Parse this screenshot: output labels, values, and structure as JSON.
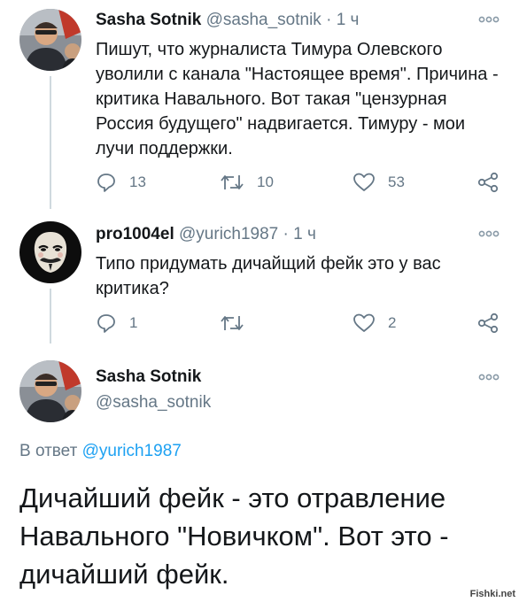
{
  "tweets": [
    {
      "name": "Sasha Sotnik",
      "handle": "@sasha_sotnik",
      "dot": "·",
      "time": "1 ч",
      "text": "Пишут, что журналиста Тимура Олевского уволили с канала \"Настоящее время\". Причина - критика Навального. Вот такая \"цензурная Россия будущего\" надвигается. Тимуру - мои лучи поддержки.",
      "replies": "13",
      "retweets": "10",
      "likes": "53",
      "avatar_icon": "person-photo-icon"
    },
    {
      "name": "pro1004el",
      "handle": "@yurich1987",
      "dot": "·",
      "time": "1 ч",
      "text": "Типо придумать дичайщий фейк это у вас критика?",
      "replies": "1",
      "retweets": "",
      "likes": "2",
      "avatar_icon": "guy-fawkes-mask-icon"
    }
  ],
  "main_tweet": {
    "name": "Sasha Sotnik",
    "handle": "@sasha_sotnik",
    "reply_prefix": "В ответ",
    "reply_handle": "@yurich1987",
    "text": "Дичайший фейк - это отравление Навального \"Новичком\". Вот это - дичайший фейк."
  },
  "watermark": "Fishki.net",
  "colors": {
    "text": "#14171a",
    "secondary": "#657786",
    "link": "#1da1f2",
    "line": "#cfd9de"
  }
}
